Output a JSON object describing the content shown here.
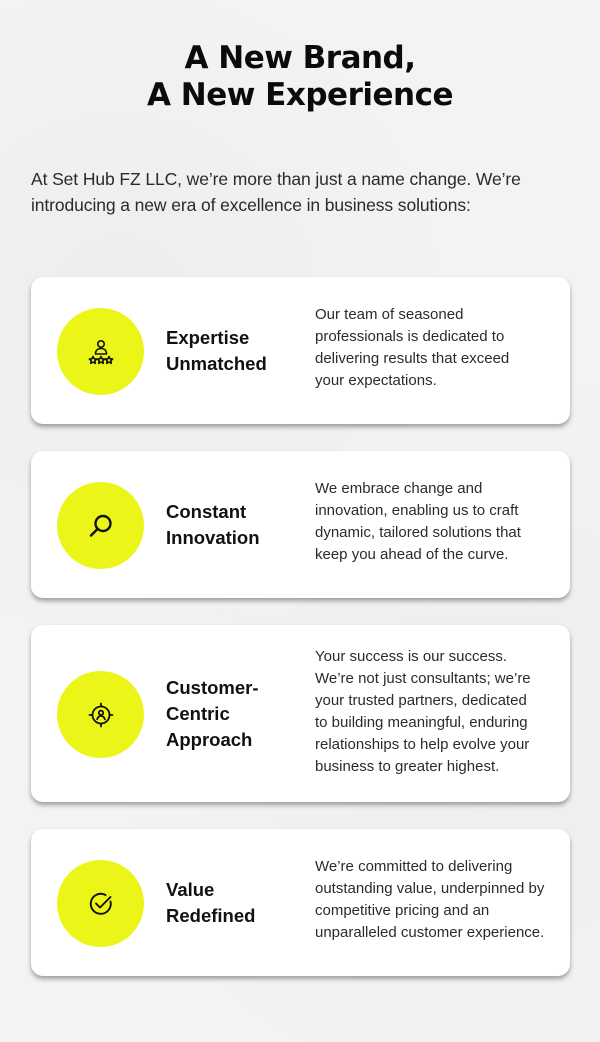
{
  "heading": {
    "line1": "A New Brand,",
    "line2": "A New Experience"
  },
  "intro": {
    "line1": "At Set Hub FZ LLC, we’re more than just a name change. We’re",
    "line2": "introducing a new era of excellence in business solutions:"
  },
  "cards": [
    {
      "icon": "expert-stars-icon",
      "title_lines": [
        "Expertise",
        "Unmatched"
      ],
      "desc_lines": [
        "Our team of seasoned",
        "professionals is dedicated to",
        "delivering results that exceed",
        "your expectations."
      ]
    },
    {
      "icon": "magnifier-icon",
      "title_lines": [
        "Constant",
        "Innovation"
      ],
      "desc_lines": [
        "We embrace change and",
        "innovation, enabling us to craft",
        "dynamic, tailored solutions that",
        "keep you ahead of the curve."
      ]
    },
    {
      "icon": "customer-target-icon",
      "title_lines": [
        "Customer-",
        "Centric",
        "Approach"
      ],
      "desc_lines": [
        "Your success is our success.",
        "We’re not just consultants; we’re",
        "your trusted partners, dedicated",
        "to building meaningful, enduring",
        "relationships to help evolve your",
        "business to greater highest."
      ]
    },
    {
      "icon": "check-circle-icon",
      "title_lines": [
        "Value",
        "Redefined"
      ],
      "desc_lines": [
        "We’re committed to delivering",
        "outstanding value, underpinned by",
        "competitive pricing and an",
        "unparalleled customer experience."
      ]
    }
  ],
  "colors": {
    "accent": "#ebf518",
    "background": "#f3f3f2",
    "card": "#ffffff",
    "text": "#111111"
  }
}
